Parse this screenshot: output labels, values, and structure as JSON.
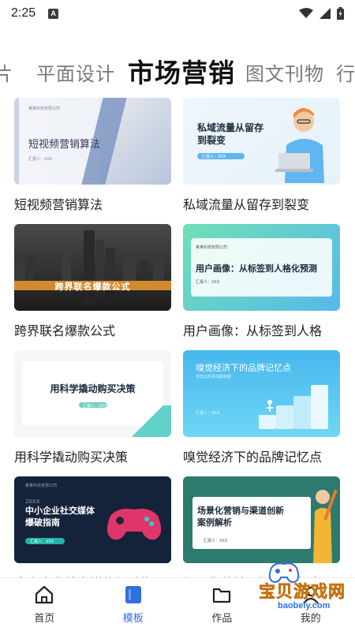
{
  "status_bar": {
    "time": "2:25",
    "notification_badge": "A",
    "icons": [
      "wifi-icon",
      "signal-icon",
      "battery-icon"
    ]
  },
  "tabs": [
    {
      "label": "片",
      "active": false
    },
    {
      "label": "平面设计",
      "active": false
    },
    {
      "label": "市场营销",
      "active": true
    },
    {
      "label": "图文刊物",
      "active": false
    },
    {
      "label": "行",
      "active": false
    }
  ],
  "templates": [
    {
      "title": "短视频营销算法",
      "thumb": {
        "company": "某某科技有限公司",
        "headline": "短视频营销算法",
        "reporter": "汇报人：XXX"
      }
    },
    {
      "title": "私域流量从留存到裂变",
      "thumb": {
        "headline_line1": "私域流量从留存",
        "headline_line2": "到裂变",
        "reporter": "汇报人：XXX"
      }
    },
    {
      "title": "跨界联名爆款公式",
      "thumb": {
        "headline": "跨界联名爆款公式"
      }
    },
    {
      "title": "用户画像：从标签到人格",
      "thumb": {
        "company": "某某科技有限公司",
        "headline": "用户画像：从标签到人格化预测",
        "reporter": "汇报人：XXX"
      }
    },
    {
      "title": "用科学撬动购买决策",
      "thumb": {
        "headline": "用科学撬动购买决策",
        "reporter": "汇报人：XXX"
      }
    },
    {
      "title": "嗅觉经济下的品牌记忆点",
      "thumb": {
        "headline": "嗅觉经济下的品牌记忆点",
        "subtitle": "单击此处添加副标题",
        "reporter": "汇报人：XXX"
      }
    },
    {
      "title": "中小企业社交媒体爆破指",
      "thumb": {
        "company": "某某科技有限公司",
        "year": "20XX",
        "headline_line1": "中小企业社交媒体",
        "headline_line2": "爆破指南",
        "reporter": "汇报人：XXX"
      }
    },
    {
      "title": "场景化营销与渠道创新案",
      "thumb": {
        "headline_line1": "场景化营销与渠道创新",
        "headline_line2": "案例解析",
        "reporter": "汇报人：XXX"
      }
    }
  ],
  "bottom_nav": [
    {
      "label": "首页",
      "icon": "home-icon",
      "active": false
    },
    {
      "label": "模板",
      "icon": "template-icon",
      "active": true
    },
    {
      "label": "作品",
      "icon": "folder-icon",
      "active": false
    },
    {
      "label": "我的",
      "icon": "profile-icon",
      "active": false
    }
  ],
  "watermark": {
    "text": "宝贝游戏网",
    "url": "baobeiy.com"
  },
  "colors": {
    "accent": "#2f6fe0",
    "text": "#222222",
    "inactive_tab": "#7a7a7a"
  }
}
